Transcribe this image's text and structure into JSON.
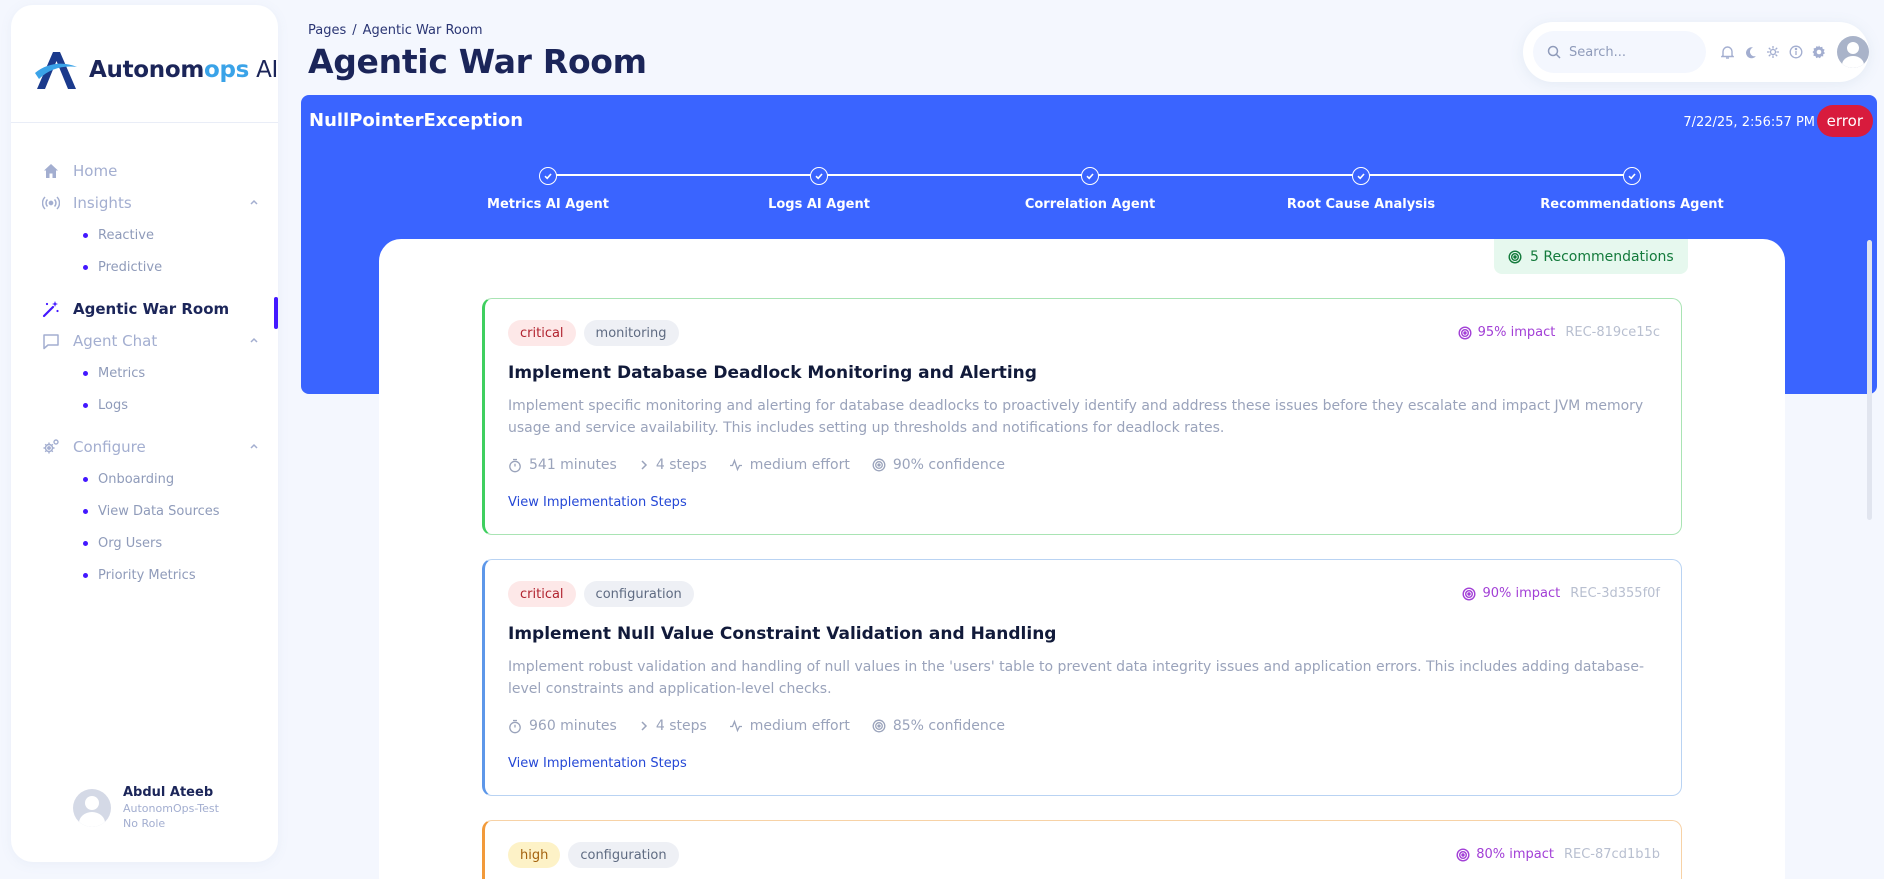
{
  "brand": {
    "name_main": "Autonom",
    "name_accent": "ops",
    "name_suffix": " AI"
  },
  "sidebar": {
    "home": "Home",
    "insights": {
      "label": "Insights",
      "items": [
        "Reactive",
        "Predictive"
      ]
    },
    "war_room": "Agentic War Room",
    "agent_chat": {
      "label": "Agent Chat",
      "items": [
        "Metrics",
        "Logs"
      ]
    },
    "configure": {
      "label": "Configure",
      "items": [
        "Onboarding",
        "View Data Sources",
        "Org Users",
        "Priority Metrics"
      ]
    }
  },
  "user": {
    "name": "Abdul Ateeb",
    "org": "AutonomOps-Test",
    "role": "No Role"
  },
  "header": {
    "breadcrumb_root": "Pages",
    "breadcrumb_sep": "/",
    "breadcrumb_current": "Agentic War Room",
    "title": "Agentic War Room",
    "search_placeholder": "Search..."
  },
  "incident": {
    "title": "NullPointerException",
    "timestamp": "7/22/25, 2:56:57 PM",
    "status": "error",
    "steps": [
      "Metrics AI Agent",
      "Logs AI Agent",
      "Correlation Agent",
      "Root Cause Analysis",
      "Recommendations Agent"
    ]
  },
  "recommendations_count": "5 Recommendations",
  "recommendations": [
    {
      "severity": "critical",
      "category": "monitoring",
      "impact": "95% impact",
      "id": "REC-819ce15c",
      "title": "Implement Database Deadlock Monitoring and Alerting",
      "description": "Implement specific monitoring and alerting for database deadlocks to proactively identify and address these issues before they escalate and impact JVM memory usage and service availability. This includes setting up thresholds and notifications for deadlock rates.",
      "duration": "541 minutes",
      "steps": "4 steps",
      "effort": "medium effort",
      "confidence": "90% confidence",
      "link": "View Implementation Steps"
    },
    {
      "severity": "critical",
      "category": "configuration",
      "impact": "90% impact",
      "id": "REC-3d355f0f",
      "title": "Implement Null Value Constraint Validation and Handling",
      "description": "Implement robust validation and handling of null values in the 'users' table to prevent data integrity issues and application errors. This includes adding database-level constraints and application-level checks.",
      "duration": "960 minutes",
      "steps": "4 steps",
      "effort": "medium effort",
      "confidence": "85% confidence",
      "link": "View Implementation Steps"
    },
    {
      "severity": "high",
      "category": "configuration",
      "impact": "80% impact",
      "id": "REC-87cd1b1b"
    }
  ],
  "colors": {
    "primary": "#3a64ff",
    "accent": "#4318ff",
    "error": "#d81b3d",
    "impact": "#a23fd6",
    "success_bg": "#e6f8ee",
    "success_text": "#137a3b"
  }
}
